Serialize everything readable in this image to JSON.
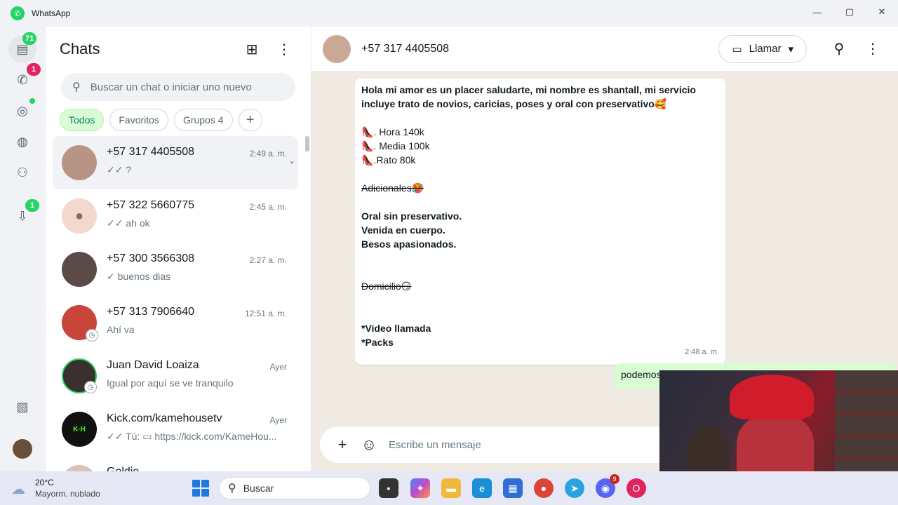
{
  "window": {
    "title": "WhatsApp",
    "controls": [
      "—",
      "▢",
      "✕"
    ]
  },
  "rail": {
    "chats_badge": "71",
    "calls_badge": "1",
    "archive_badge": "1"
  },
  "chatlist": {
    "title": "Chats",
    "search_placeholder": "Buscar un chat o iniciar uno nuevo",
    "filters": [
      "Todos",
      "Favoritos",
      "Grupos 4",
      "+"
    ],
    "items": [
      {
        "name": "+57 317 4405508",
        "time": "2:49 a. m.",
        "last": "✓✓ ?",
        "avatar_color": "#b89484"
      },
      {
        "name": "+57 322 5660775",
        "time": "2:45 a. m.",
        "last": "✓✓ ah ok",
        "avatar_color": "#f2d8ce"
      },
      {
        "name": "+57 300 3566308",
        "time": "2:27 a. m.",
        "last": "✓ buenos dias",
        "avatar_color": "#5c4a46"
      },
      {
        "name": "+57 313 7906640",
        "time": "12:51 a. m.",
        "last": "Ahí va",
        "avatar_color": "#c8453a"
      },
      {
        "name": "Juan David Loaiza",
        "time": "Ayer",
        "last": "Igual por aquí se ve tranquilo",
        "avatar_color": "#3b3030"
      },
      {
        "name": "Kick.com/kamehousetv",
        "time": "Ayer",
        "last": "✓✓ Tú: ▭ https://kick.com/KameHou...",
        "avatar_color": "#111111"
      },
      {
        "name": "Goldie",
        "time": "",
        "last": "",
        "avatar_color": "#d8c2b5"
      }
    ]
  },
  "conversation": {
    "contact": "+57 317 4405508",
    "call_label": "Llamar",
    "incoming": {
      "lines": [
        {
          "text": "Hola mi amor es un placer saludarte, mi nombre es shantall, mi servicio incluye trato de novios, caricias, poses y oral con preservativo🥰",
          "style": "bold"
        },
        {
          "text": "",
          "style": ""
        },
        {
          "text": "👠. Hora 140k",
          "style": ""
        },
        {
          "text": "👠. Media 100k",
          "style": ""
        },
        {
          "text": "👠.Rato 80k",
          "style": ""
        },
        {
          "text": "",
          "style": ""
        },
        {
          "text": "Adicionales🥵",
          "style": "strike"
        },
        {
          "text": "",
          "style": ""
        },
        {
          "text": "Oral sin preservativo.",
          "style": "bold"
        },
        {
          "text": "Venida en cuerpo.",
          "style": "bold"
        },
        {
          "text": "Besos apasionados.",
          "style": "bold"
        },
        {
          "text": "",
          "style": ""
        },
        {
          "text": "",
          "style": ""
        },
        {
          "text": "Domicilio😏",
          "style": "strike"
        },
        {
          "text": "",
          "style": ""
        },
        {
          "text": "",
          "style": ""
        },
        {
          "text": "*Video llamada",
          "style": "bold"
        },
        {
          "text": "*Packs",
          "style": "bold"
        }
      ],
      "time": "2:48 a. m."
    },
    "outgoing_preview": "podemos",
    "composer_placeholder": "Escribe un mensaje"
  },
  "taskbar": {
    "weather_temp": "20°C",
    "weather_desc": "Mayorm. nublado",
    "search_label": "Buscar",
    "discord_badge": "9"
  }
}
